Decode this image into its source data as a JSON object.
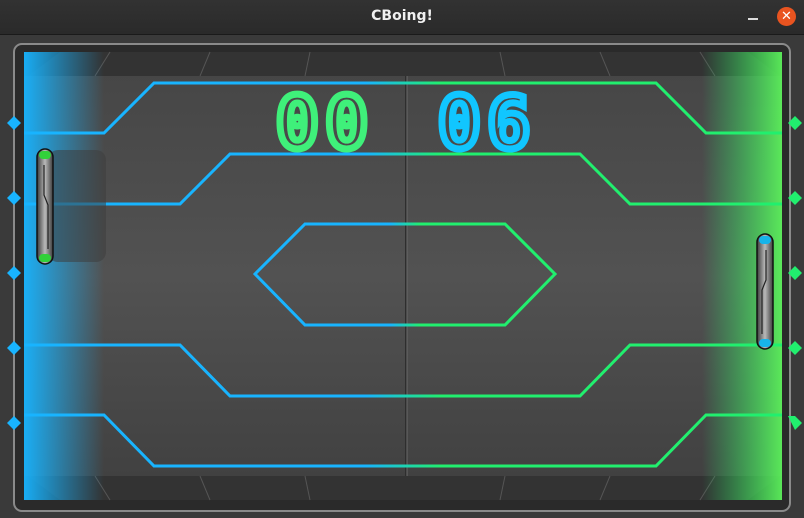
{
  "window": {
    "title": "CBoing!",
    "minimize_icon": "minimize-icon",
    "close_icon": "close-icon",
    "close_glyph": "✕"
  },
  "game": {
    "score_left": "00",
    "score_right": "06",
    "colors": {
      "left_side": "#18b4ff",
      "right_side": "#21ef6e",
      "left_score": "#3ff07a",
      "right_score": "#11c6ff",
      "board": "#4a4a4a",
      "close_button": "#e95420"
    },
    "left_paddle": {
      "cap_color": "#32d13a"
    },
    "right_paddle": {
      "cap_color": "#17b4ea"
    }
  }
}
